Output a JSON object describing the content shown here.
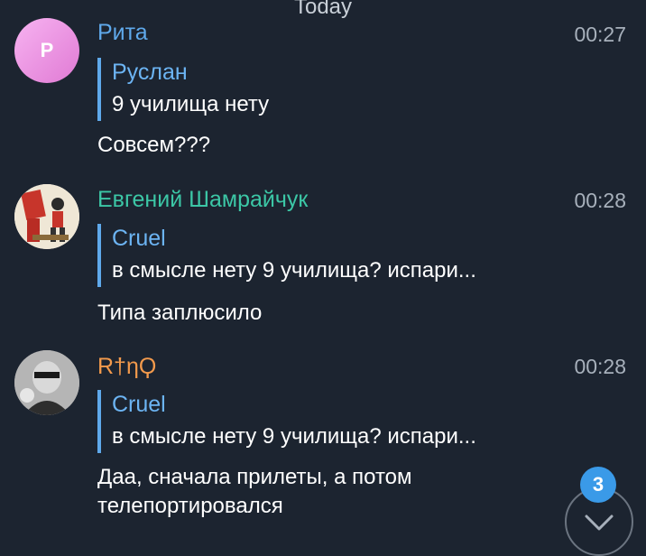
{
  "date_divider": "Today",
  "messages": [
    {
      "avatar_letter": "P",
      "name": "Рита",
      "name_color": "#5fa9eb",
      "time": "00:27",
      "reply_author": "Руслан",
      "reply_text": "9 училища нету",
      "text": "Совсем???"
    },
    {
      "name": "Евгений Шамрайчук",
      "name_color": "#3cc7a6",
      "time": "00:28",
      "reply_author": "Cruel",
      "reply_text": "в смысле нету 9 училища? испари...",
      "text": "Типа заплюсило"
    },
    {
      "name": "R†ηϘ",
      "name_color": "#f39a4c",
      "time": "00:28",
      "reply_author": "Cruel",
      "reply_text": "в смысле нету 9 училища? испари...",
      "text_line1": "Даа,  сначала прилеты,  а потом",
      "text_line2": "телепортировался"
    }
  ],
  "unread_badge": "3",
  "scroll_icon": "chevron-down-icon"
}
